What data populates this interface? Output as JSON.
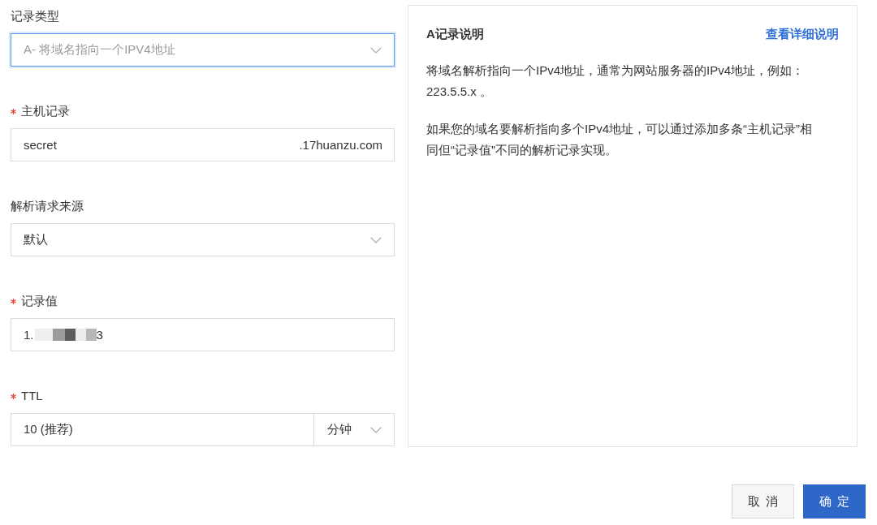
{
  "form": {
    "fields": [
      {
        "kind": "select",
        "label": "记录类型",
        "required": false,
        "value": "A- 将域名指向一个IPV4地址",
        "focused": true
      },
      {
        "kind": "suffix-input",
        "label": "主机记录",
        "required": true,
        "value": "secret",
        "suffix": ".17huanzu.com"
      },
      {
        "kind": "select",
        "label": "解析请求来源",
        "required": false,
        "value": "默认",
        "focused": false
      },
      {
        "kind": "redacted-input",
        "label": "记录值",
        "required": true,
        "value_start": "1.",
        "value_end": "3"
      },
      {
        "kind": "unit-input",
        "label": "TTL",
        "required": true,
        "value": "10 (推荐)",
        "unit": "分钟"
      }
    ]
  },
  "help_panel": {
    "title": "A记录说明",
    "link": "查看详细说明",
    "paragraphs": [
      "将域名解析指向一个IPv4地址，通常为网站服务器的IPv4地址，例如：223.5.5.x 。",
      "如果您的域名要解析指向多个IPv4地址，可以通过添加多条“主机记录”相同但“记录值”不同的解析记录实现。"
    ]
  },
  "buttons": [
    {
      "label": "取消",
      "primary": false
    },
    {
      "label": "确定",
      "primary": true
    }
  ]
}
